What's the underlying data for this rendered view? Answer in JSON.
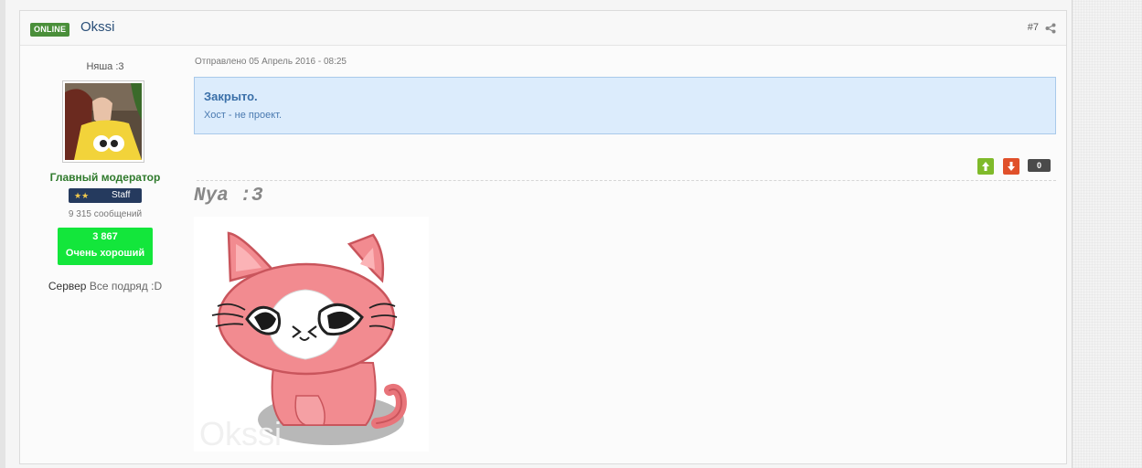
{
  "post": {
    "online_badge": "ONLINE",
    "author": "Okssi",
    "number": "#7",
    "date": "Отправлено 05 Апрель 2016 - 08:25"
  },
  "author_info": {
    "title": "Няша :3",
    "group": "Главный модератор",
    "staff_label": "Staff",
    "staff_stars": "★★",
    "post_count": "9 315 сообщений",
    "reputation_value": "3 867",
    "reputation_label": "Очень хороший",
    "server_label": "Сервер",
    "server_value": "Все подряд :D"
  },
  "content": {
    "notice_title": "Закрыто.",
    "notice_text": "Хост - не проект."
  },
  "rating": {
    "count": "0"
  },
  "signature": {
    "text": "Nya :3",
    "image_watermark": "Okssi"
  },
  "colors": {
    "online": "#4a8f3a",
    "group": "#2f7a2c",
    "reputation_bg": "#13e63b",
    "notice_bg": "#dcecfc",
    "rate_up": "#7fba2a",
    "rate_down": "#e0502a"
  }
}
